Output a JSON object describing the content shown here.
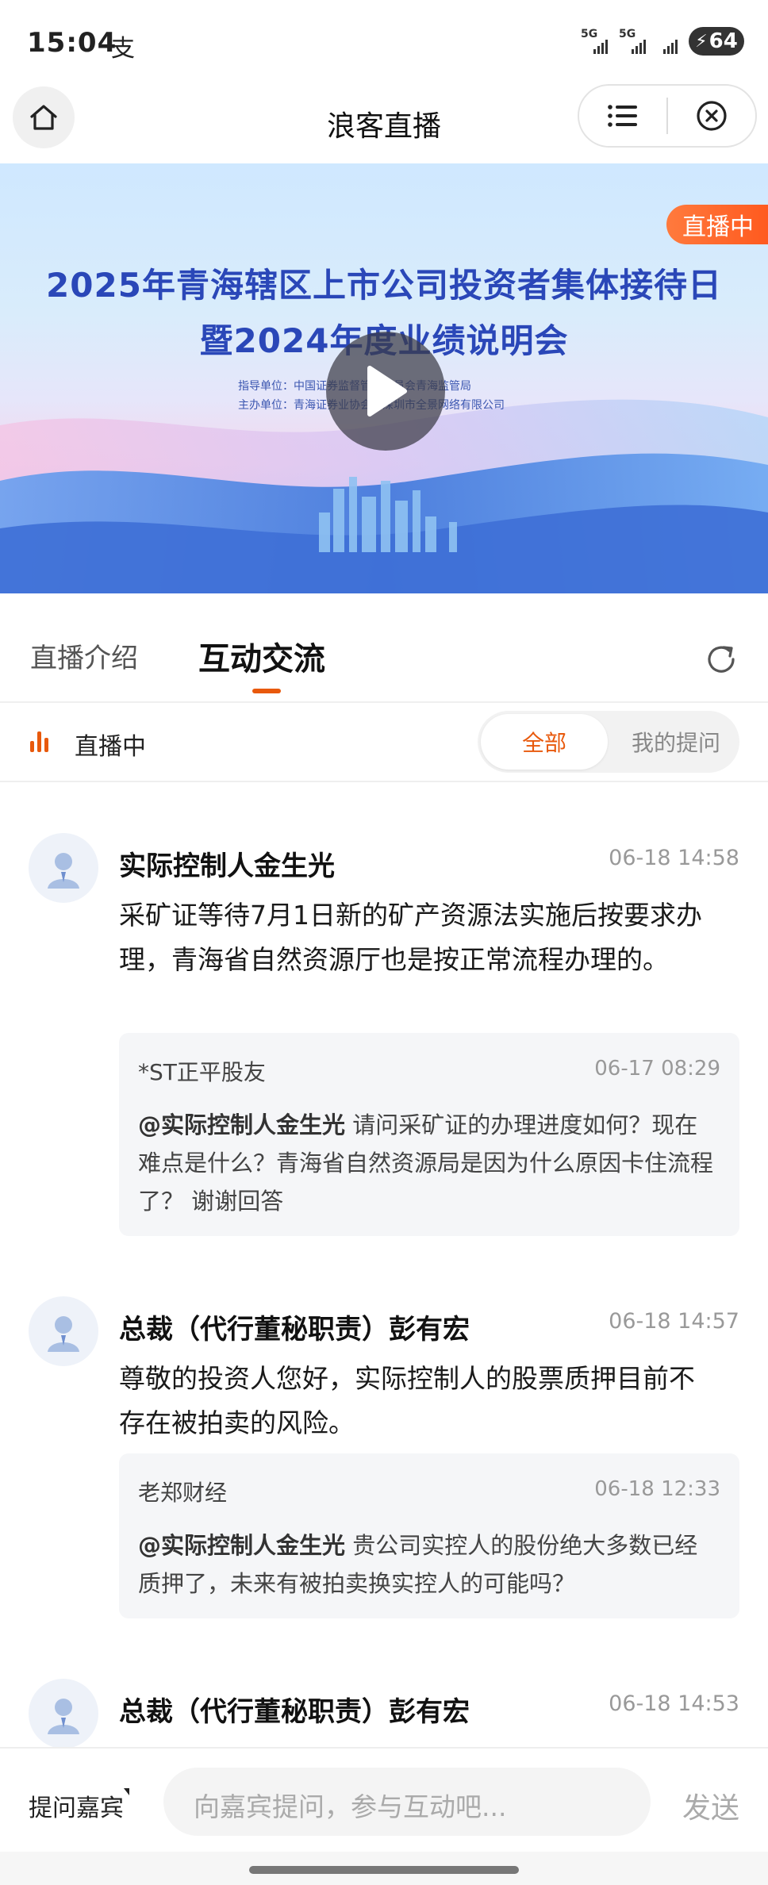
{
  "status_bar": {
    "time": "15:04",
    "app_icon": "支",
    "network1": "5G",
    "network2": "5G",
    "battery": "64"
  },
  "nav": {
    "title": "浪客直播",
    "home_icon": "home-icon",
    "menu_icon": "list-menu-icon",
    "close_icon": "close-circle-icon"
  },
  "banner": {
    "title_line1": "2025年青海辖区上市公司投资者集体接待日",
    "title_line2": "暨2024年度业绩说明会",
    "org_line1": "指导单位：中国证券监督管理委员会青海监管局",
    "org_line2": "主办单位：青海证券业协会、深圳市全景网络有限公司",
    "live_badge": "直播中",
    "play_icon": "play-icon"
  },
  "tabs": {
    "intro": "直播介绍",
    "interaction": "互动交流",
    "active": "interaction"
  },
  "filter": {
    "live_label": "直播中",
    "all": "全部",
    "mine": "我的提问",
    "selected": "all"
  },
  "messages": [
    {
      "name": "实际控制人金生光",
      "time": "06-18 14:58",
      "text": "采矿证等待7月1日新的矿产资源法实施后按要求办理，青海省自然资源厅也是按正常流程办理的。",
      "quote": {
        "user": "*ST正平股友",
        "time": "06-17 08:29",
        "mention": "@实际控制人金生光",
        "text": " 请问采矿证的办理进度如何？现在难点是什么？青海省自然资源局是因为什么原因卡住流程了？ 谢谢回答"
      }
    },
    {
      "name": "总裁（代行董秘职责）彭有宏",
      "time": "06-18 14:57",
      "text": "尊敬的投资人您好，实际控制人的股票质押目前不存在被拍卖的风险。",
      "quote": {
        "user": "老郑财经",
        "time": "06-18 12:33",
        "mention": "@实际控制人金生光",
        "text": " 贵公司实控人的股份绝大多数已经质押了，未来有被拍卖换实控人的可能吗？"
      }
    },
    {
      "name": "总裁（代行董秘职责）彭有宏",
      "time": "06-18 14:53"
    }
  ],
  "bottom": {
    "ask_guest": "提问嘉宾",
    "input_placeholder": "向嘉宾提问，参与互动吧...",
    "send": "发送"
  },
  "colors": {
    "accent": "#e8590c",
    "live_badge": "#ff6a2b",
    "banner_title": "#2a47b8"
  }
}
